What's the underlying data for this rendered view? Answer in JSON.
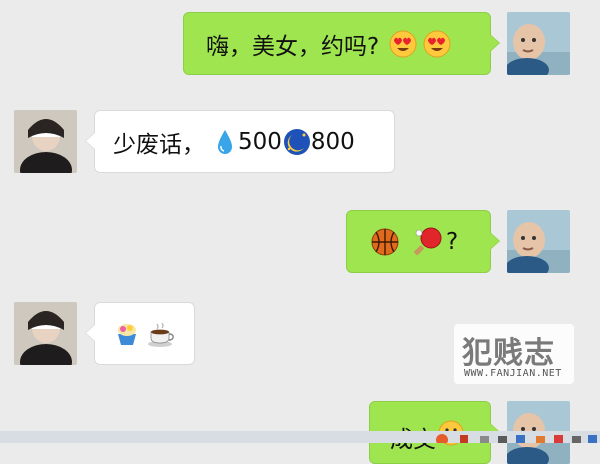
{
  "conversation": {
    "messages": [
      {
        "side": "right",
        "text": "嗨，美女，约吗?",
        "emoji": [
          "heart-eyes-emoji",
          "heart-eyes-emoji"
        ]
      },
      {
        "side": "left",
        "text": "少废话，",
        "parts": [
          {
            "icon": "water-drop-emoji"
          },
          {
            "text": "500"
          },
          {
            "icon": "moon-face-emoji"
          },
          {
            "text": "800"
          }
        ]
      },
      {
        "side": "right",
        "text": "?",
        "emoji": [
          "basketball-emoji",
          "ping-pong-emoji"
        ]
      },
      {
        "side": "left",
        "text": "",
        "emoji": [
          "shaved-ice-emoji",
          "coffee-emoji"
        ]
      },
      {
        "side": "right",
        "text": "成交",
        "emoji": [
          "grin-emoji"
        ]
      }
    ]
  },
  "m1": {
    "text": "嗨，美女，约吗?"
  },
  "m2": {
    "text": "少废话，",
    "num1": "500",
    "num2": "800"
  },
  "m3": {
    "text": "?"
  },
  "m5": {
    "text": "成交"
  },
  "watermark": {
    "title": "犯贱志",
    "subtitle": "WWW.FANJIAN.NET"
  },
  "colors": {
    "background": "#ebebeb",
    "outgoing_bubble": "#9fe550",
    "incoming_bubble": "#ffffff"
  }
}
